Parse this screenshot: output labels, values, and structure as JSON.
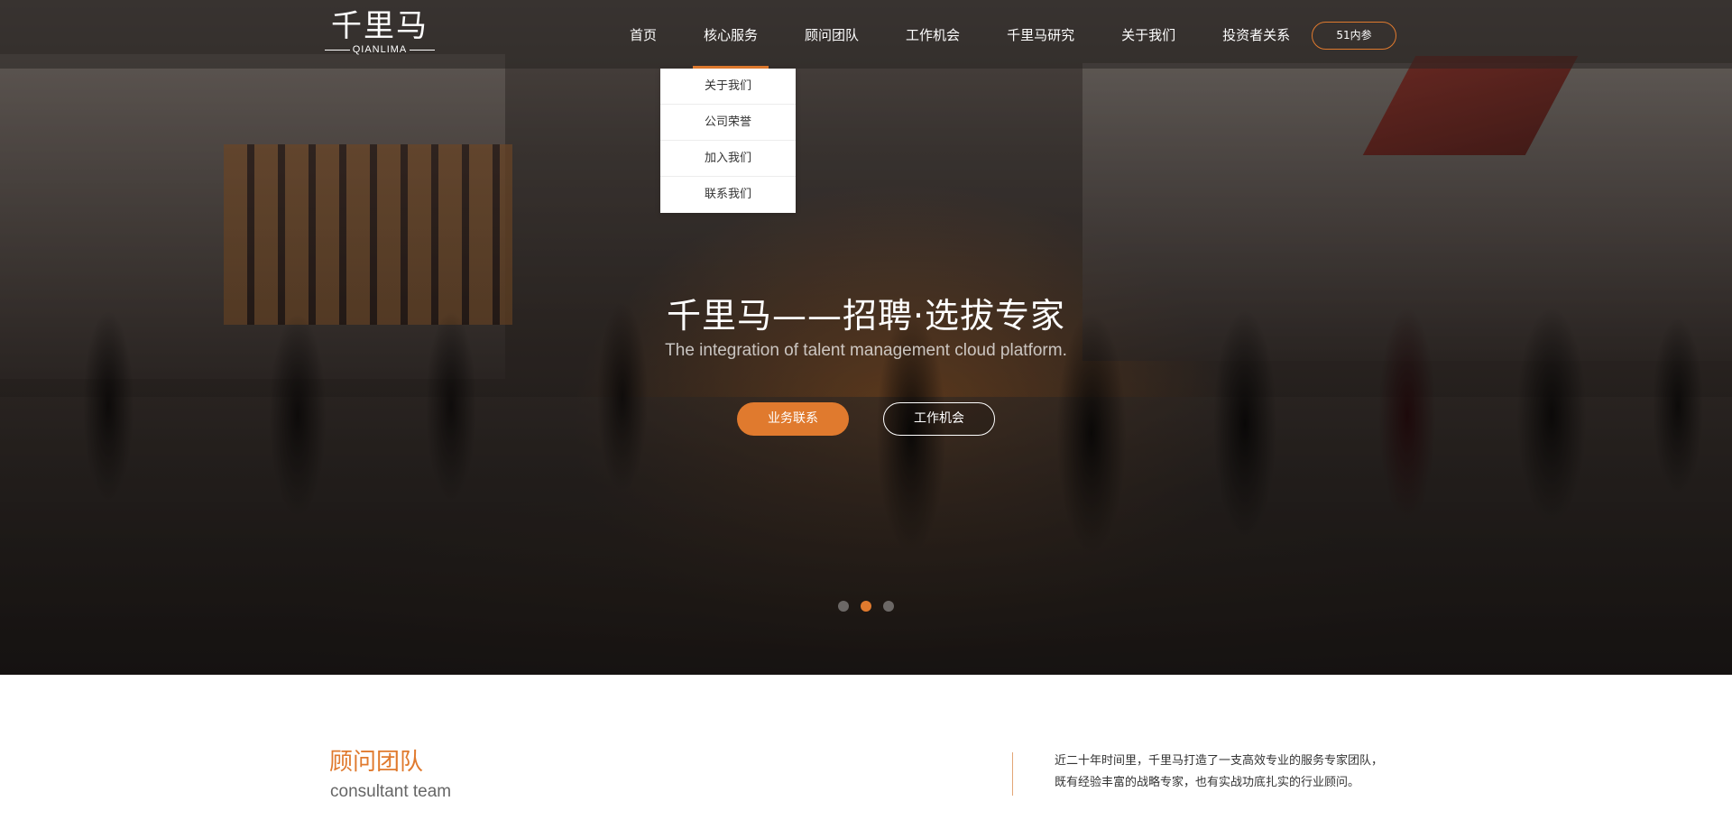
{
  "nav": {
    "logo_cn": "千里马",
    "logo_en": "QIANLIMA",
    "items": [
      {
        "label": "首页"
      },
      {
        "label": "核心服务"
      },
      {
        "label": "顾问团队"
      },
      {
        "label": "工作机会"
      },
      {
        "label": "千里马研究"
      },
      {
        "label": "关于我们"
      },
      {
        "label": "投资者关系"
      }
    ],
    "active_index": 1,
    "cta_label": "51内参",
    "dropdown": [
      {
        "label": "关于我们"
      },
      {
        "label": "公司荣誉"
      },
      {
        "label": "加入我们"
      },
      {
        "label": "联系我们"
      }
    ]
  },
  "hero": {
    "title": "千里马——招聘·选拔专家",
    "subtitle": "The integration of talent management cloud platform.",
    "primary_button": "业务联系",
    "secondary_button": "工作机会",
    "slides_count": 3,
    "active_slide": 2
  },
  "team": {
    "title": "顾问团队",
    "subtitle": "consultant team",
    "desc_line1": "近二十年时间里，千里马打造了一支高效专业的服务专家团队，",
    "desc_line2": "既有经验丰富的战略专家，也有实战功底扎实的行业顾问。"
  },
  "colors": {
    "accent": "#e07a2e",
    "nav_bg": "rgba(40,36,34,0.55)",
    "text_dark": "#333333"
  }
}
